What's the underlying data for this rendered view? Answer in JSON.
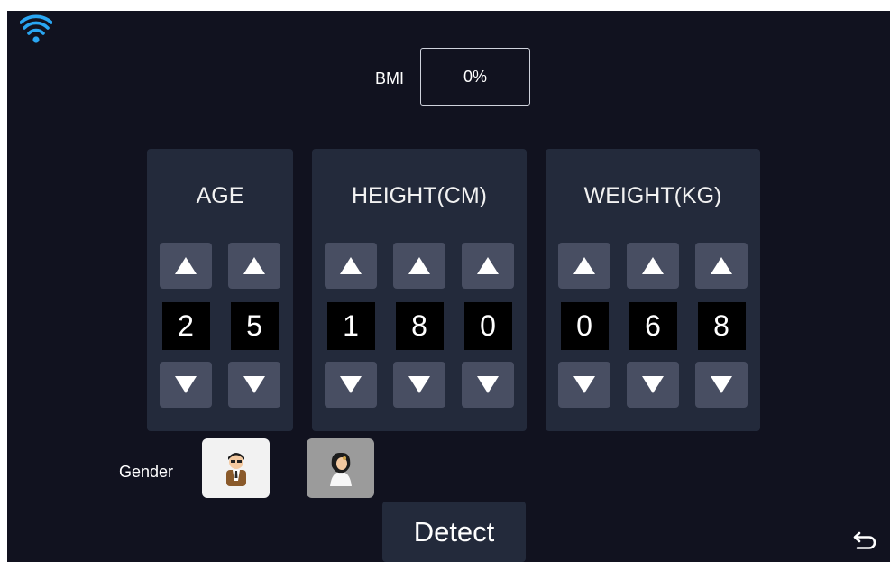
{
  "bmi": {
    "label": "BMI",
    "value": "0%"
  },
  "panels": [
    {
      "title": "AGE",
      "digits": [
        "2",
        "5"
      ]
    },
    {
      "title": "HEIGHT(CM)",
      "digits": [
        "1",
        "8",
        "0"
      ]
    },
    {
      "title": "WEIGHT(KG)",
      "digits": [
        "0",
        "6",
        "8"
      ]
    }
  ],
  "gender": {
    "label": "Gender",
    "options": [
      "male",
      "female"
    ],
    "selected": "male"
  },
  "detect_button": {
    "label": "Detect"
  },
  "icons": {
    "status": "wifi-icon",
    "back": "back-arrow-icon"
  },
  "colors": {
    "background": "#11121f",
    "panel": "#232a3b",
    "stepper_button": "#484e62",
    "digit_bg": "#000000",
    "wifi": "#2aa6f2"
  }
}
